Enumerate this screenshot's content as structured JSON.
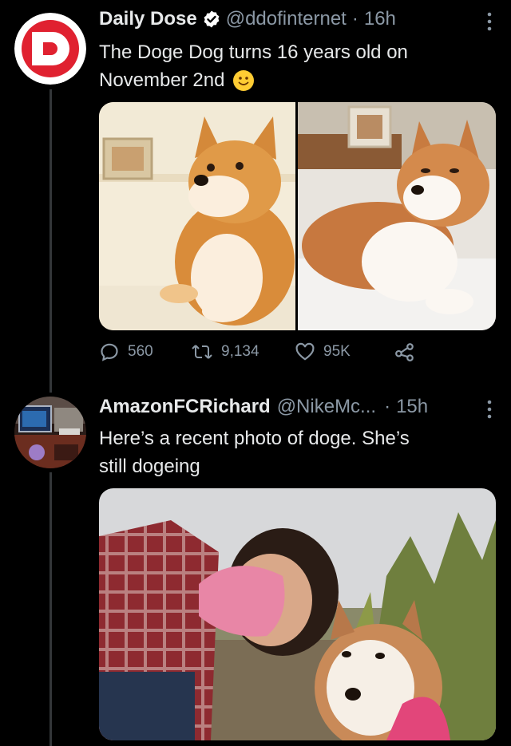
{
  "tweet1": {
    "display_name": "Daily Dose",
    "handle": "@ddofinternet",
    "separator": "·",
    "time": "16h",
    "text_line1": "The Doge Dog turns 16 years old on",
    "text_line2": "November 2nd",
    "verified_icon": "verified-badge-icon",
    "emoji": "slightly-smiling-face-emoji",
    "avatar_letter": "D",
    "avatar_color": "#e02130",
    "actions": {
      "replies": "560",
      "retweets": "9,134",
      "likes": "95K"
    }
  },
  "tweet2": {
    "display_name": "AmazonFCRichard",
    "handle": "@NikeMc...",
    "separator": "·",
    "time": "15h",
    "text_line1": "Here’s a recent photo of doge. She’s",
    "text_line2": "still dogeing"
  },
  "colors": {
    "background": "#000000",
    "text": "#e7e9ea",
    "muted": "#8b98a5",
    "verified": "#ffffff",
    "thread_line": "#333639"
  }
}
